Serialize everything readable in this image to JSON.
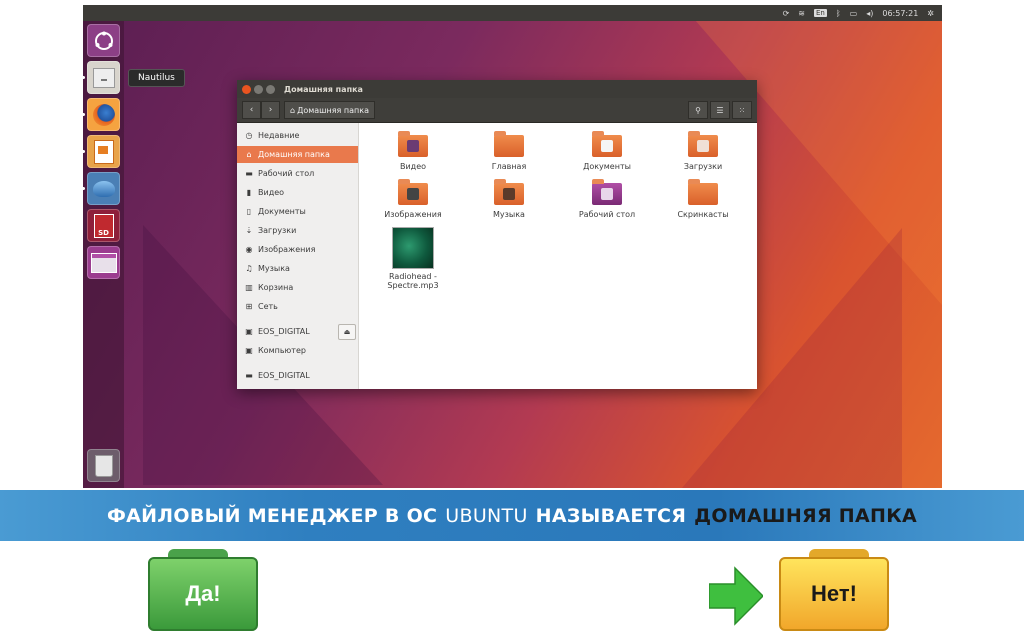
{
  "topbar": {
    "lang": "En",
    "volume": "◂)",
    "clock": "06:57:21"
  },
  "launcher": {
    "tooltip": "Nautilus"
  },
  "window": {
    "title": "Домашняя папка",
    "breadcrumb": "Домашняя папка",
    "sidebar": [
      {
        "label": "Недавние",
        "icon": "clock-icon"
      },
      {
        "label": "Домашняя папка",
        "icon": "home-icon",
        "active": true
      },
      {
        "label": "Рабочий стол",
        "icon": "desktop-icon"
      },
      {
        "label": "Видео",
        "icon": "video-icon"
      },
      {
        "label": "Документы",
        "icon": "document-icon"
      },
      {
        "label": "Загрузки",
        "icon": "download-icon"
      },
      {
        "label": "Изображения",
        "icon": "camera-icon"
      },
      {
        "label": "Музыка",
        "icon": "music-icon"
      },
      {
        "label": "Корзина",
        "icon": "trash-icon"
      },
      {
        "label": "Сеть",
        "icon": "network-icon"
      },
      {
        "label": "EOS_DIGITAL",
        "icon": "drive-icon"
      },
      {
        "label": "Компьютер",
        "icon": "computer-icon"
      },
      {
        "label": "EOS_DIGITAL",
        "icon": "folder-icon"
      }
    ],
    "files": [
      {
        "label": "Видео"
      },
      {
        "label": "Главная"
      },
      {
        "label": "Документы"
      },
      {
        "label": "Загрузки"
      },
      {
        "label": "Изображения"
      },
      {
        "label": "Музыка"
      },
      {
        "label": "Рабочий стол"
      },
      {
        "label": "Скринкасты"
      },
      {
        "label": "Radiohead - Spectre.mp3"
      }
    ]
  },
  "banner": {
    "part1": "ФАЙЛОВЫЙ МЕНЕДЖЕР В ОС",
    "part2": "UBUNTU",
    "part3": "НАЗЫВАЕТСЯ",
    "part4": "ДОМАШНЯЯ ПАПКА"
  },
  "answers": {
    "yes": "Да!",
    "no": "Нет!"
  },
  "colors": {
    "accent": "#e9794c",
    "banner": "#2f7fc0",
    "yes": "#3b9a3b",
    "no": "#f1a72b"
  }
}
